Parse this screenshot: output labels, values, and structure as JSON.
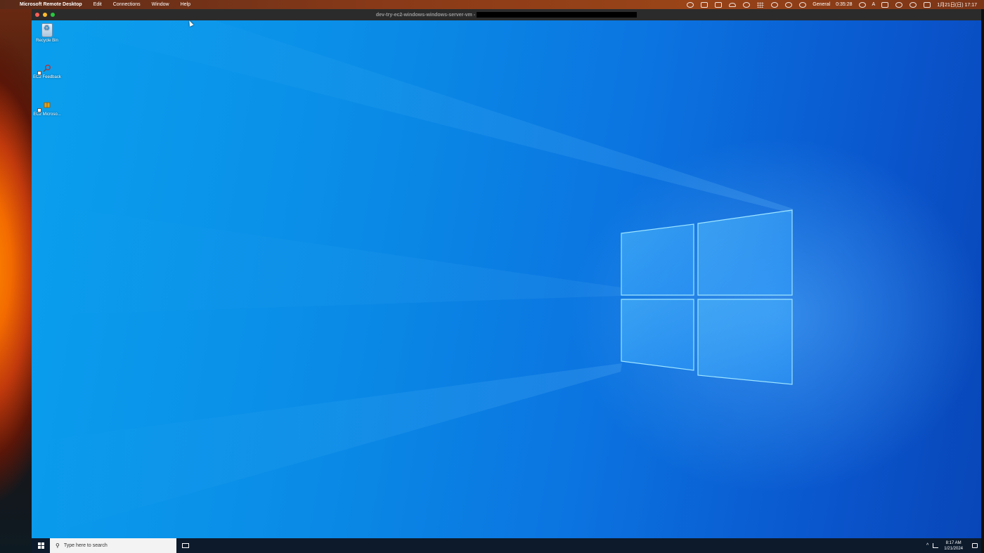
{
  "mac_menubar": {
    "app_name": "Microsoft Remote Desktop",
    "menus": [
      "Edit",
      "Connections",
      "Window",
      "Help"
    ],
    "status_profile": "General",
    "status_timer": "0:35:28",
    "input_mode": "A",
    "date_time": "1月21日(日) 17:17"
  },
  "rdp_window": {
    "title": "dev-try-ec2-windows-windows-server-vm -"
  },
  "desktop_icons": [
    {
      "label": "Recycle Bin",
      "icon": "recycle-bin-icon"
    },
    {
      "label": "EC2 Feedback",
      "icon": "magnifier-icon"
    },
    {
      "label": "EC2 Microso...",
      "icon": "package-icon"
    }
  ],
  "taskbar": {
    "search_placeholder": "Type here to search",
    "clock_time": "8:17 AM",
    "clock_date": "1/21/2024"
  },
  "colors": {
    "desktop_blue": "#0a8be6",
    "taskbar": "#0c1a2c",
    "mac_close": "#ff5f57",
    "mac_minimize": "#febc2e",
    "mac_maximize": "#28c840"
  }
}
